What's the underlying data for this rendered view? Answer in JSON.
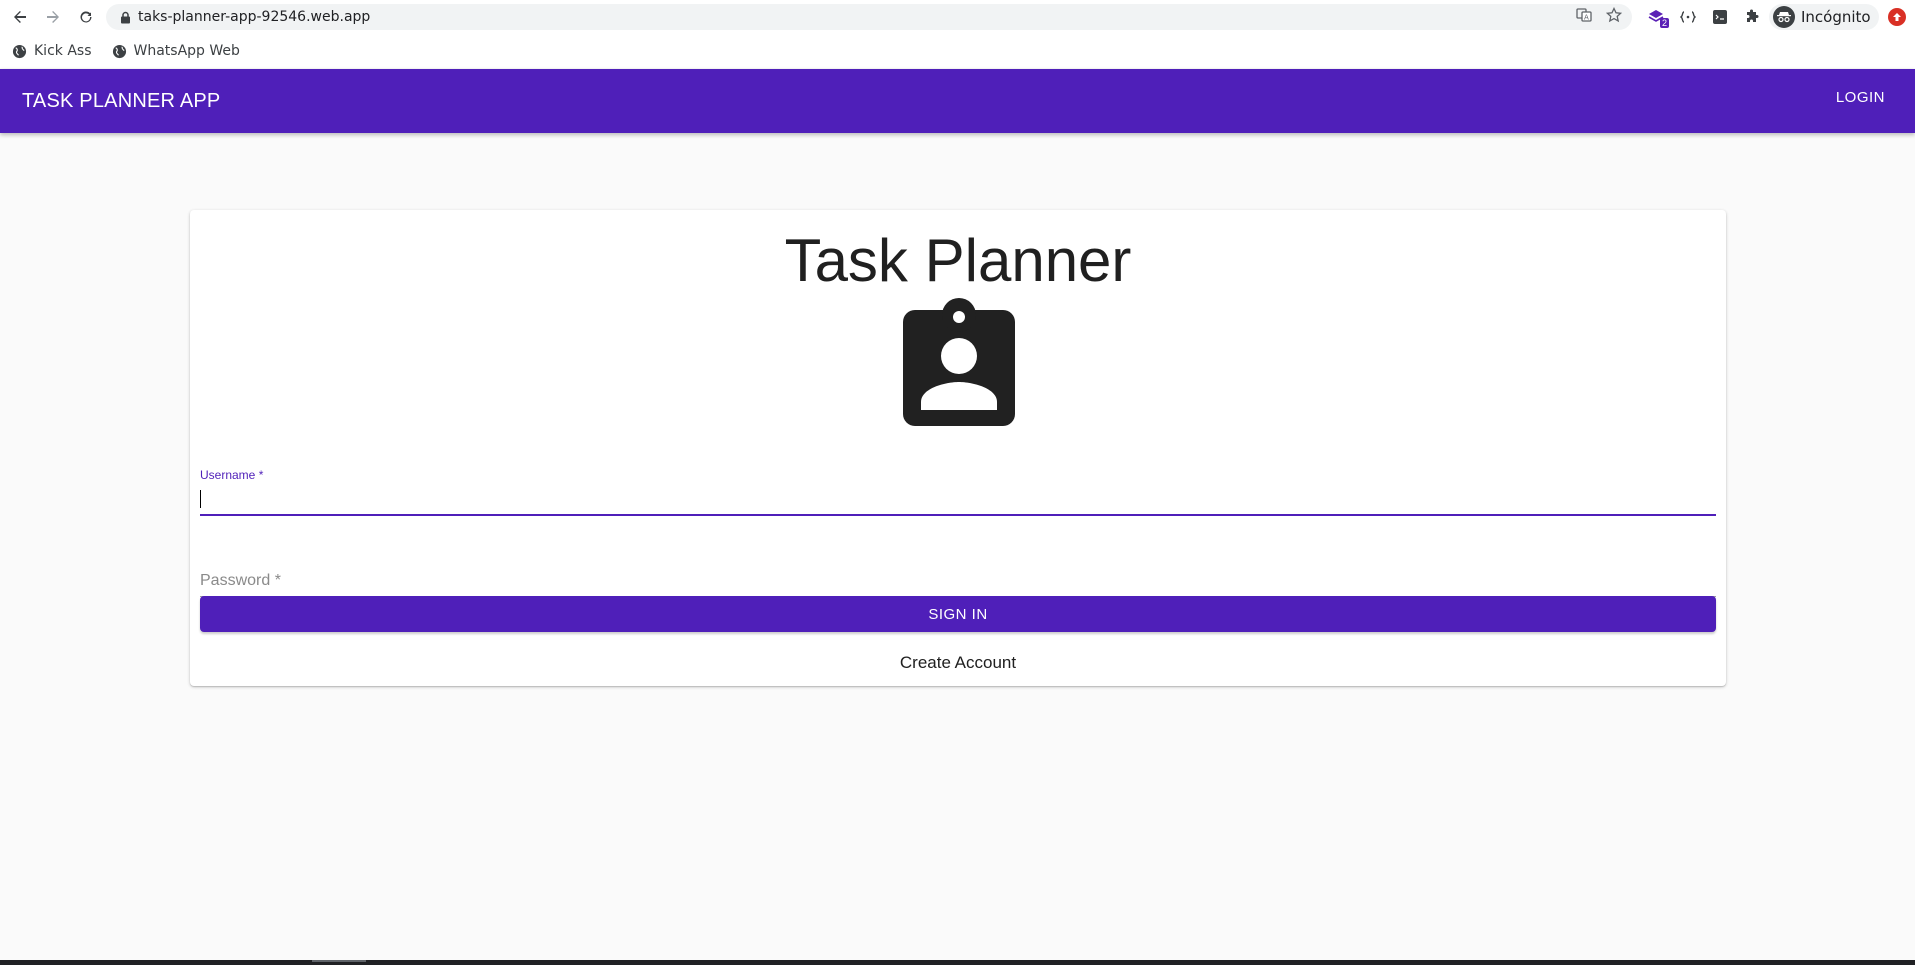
{
  "browser": {
    "url": "taks-planner-app-92546.web.app",
    "profile_label": "Incógnito",
    "extension_badge": "2",
    "bookmarks": [
      {
        "label": "Kick Ass",
        "icon": "globe-icon"
      },
      {
        "label": "WhatsApp Web",
        "icon": "globe-icon"
      }
    ]
  },
  "app_bar": {
    "title": "TASK PLANNER APP",
    "login_label": "LOGIN"
  },
  "login_card": {
    "heading": "Task Planner",
    "icon": "assignment-ind-icon",
    "username": {
      "label": "Username *",
      "value": ""
    },
    "password": {
      "label": "Password *",
      "value": ""
    },
    "signin_label": "SIGN IN",
    "create_account_label": "Create Account"
  },
  "colors": {
    "primary": "#4f1fb9",
    "background": "#fafafa",
    "card": "#ffffff",
    "text": "#202020"
  }
}
